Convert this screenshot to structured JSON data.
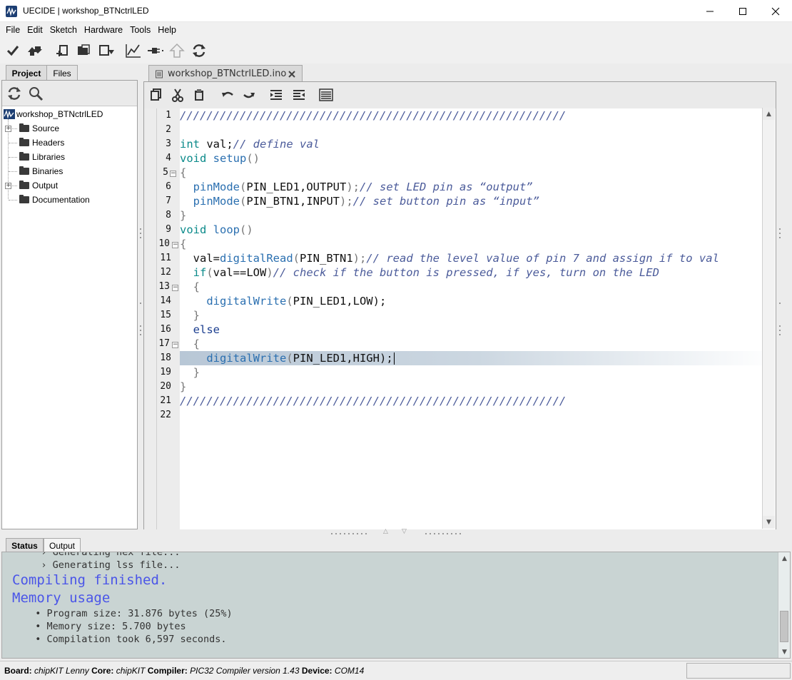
{
  "window": {
    "title": "UECIDE | workshop_BTNctrlLED"
  },
  "menu": [
    "File",
    "Edit",
    "Sketch",
    "Hardware",
    "Tools",
    "Help"
  ],
  "toolbar_icons": [
    "compile-check-icon",
    "upload-icon",
    "new-file-icon",
    "open-icon",
    "save-icon",
    "serial-plotter-icon",
    "serial-connect-icon",
    "upload-network-icon",
    "refresh-icon"
  ],
  "left_tabs": [
    "Project",
    "Files"
  ],
  "tree": {
    "root": "workshop_BTNctrlLED",
    "children": [
      "Source",
      "Headers",
      "Libraries",
      "Binaries",
      "Output",
      "Documentation"
    ]
  },
  "editor": {
    "tab_label": "workshop_BTNctrlLED.ino",
    "line_numbers": [
      "1",
      "2",
      "3",
      "4",
      "5",
      "6",
      "7",
      "8",
      "9",
      "10",
      "11",
      "12",
      "13",
      "14",
      "15",
      "16",
      "17",
      "18",
      "19",
      "20",
      "21",
      "22"
    ]
  },
  "code": {
    "l1": "//////////////////////////////////////////////////////////",
    "l3_kw": "int",
    "l3_id": " val;",
    "l3_cm": "// define val",
    "l4_kw": "void",
    "l4_fn": " setup",
    "l4_pn": "()",
    "l5": "{",
    "l6_fn": "  pinMode",
    "l6_pn1": "(",
    "l6_args": "PIN_LED1,OUTPUT",
    "l6_pn2": ");",
    "l6_cm": "// set LED pin as “output”",
    "l7_fn": "  pinMode",
    "l7_pn1": "(",
    "l7_args": "PIN_BTN1,INPUT",
    "l7_pn2": ");",
    "l7_cm": "// set button pin as “input”",
    "l8": "}",
    "l9_kw": "void",
    "l9_fn": " loop",
    "l9_pn": "()",
    "l10": "{",
    "l11_id": "  val=",
    "l11_fn": "digitalRead",
    "l11_pn1": "(",
    "l11_args": "PIN_BTN1",
    "l11_pn2": ");",
    "l11_cm": "// read the level value of pin 7 and assign if to val",
    "l12_kw": "  if",
    "l12_pn1": "(",
    "l12_args": "val==LOW",
    "l12_pn2": ")",
    "l12_cm": "// check if the button is pressed, if yes, turn on the LED",
    "l13": "  {",
    "l14_fn": "    digitalWrite",
    "l14_pn1": "(",
    "l14_args": "PIN_LED1,LOW",
    "l14_pn2": ");",
    "l15": "  }",
    "l16_kw": "  else",
    "l17": "  {",
    "l18_fn": "    digitalWrite",
    "l18_pn1": "(",
    "l18_args": "PIN_LED1,HIGH",
    "l18_pn2": ");",
    "l19": "  }",
    "l20": "}",
    "l21": "//////////////////////////////////////////////////////////"
  },
  "bottom_tabs": [
    "Status",
    "Output"
  ],
  "console": {
    "partial": "   › Generating hex file...",
    "lss": "   › Generating lss file...",
    "compiled": "Compiling finished.",
    "memory": "Memory usage",
    "program": "  • Program size: 31.876 bytes (25%)",
    "memsize": "  • Memory size: 5.700 bytes",
    "time": "  • Compilation took 6,597 seconds."
  },
  "status": {
    "board_k": "Board:",
    "board_v": " chipKIT Lenny ",
    "core_k": "Core:",
    "core_v": " chipKIT ",
    "compiler_k": "Compiler:",
    "compiler_v": " PIC32 Compiler version 1.43 ",
    "device_k": "Device:",
    "device_v": " COM14"
  },
  "colors": {
    "keyword": "#0b8a8a",
    "comment": "#4b5b9a",
    "console_bg": "#c9d4d3",
    "console_accent": "#4a55e8"
  }
}
